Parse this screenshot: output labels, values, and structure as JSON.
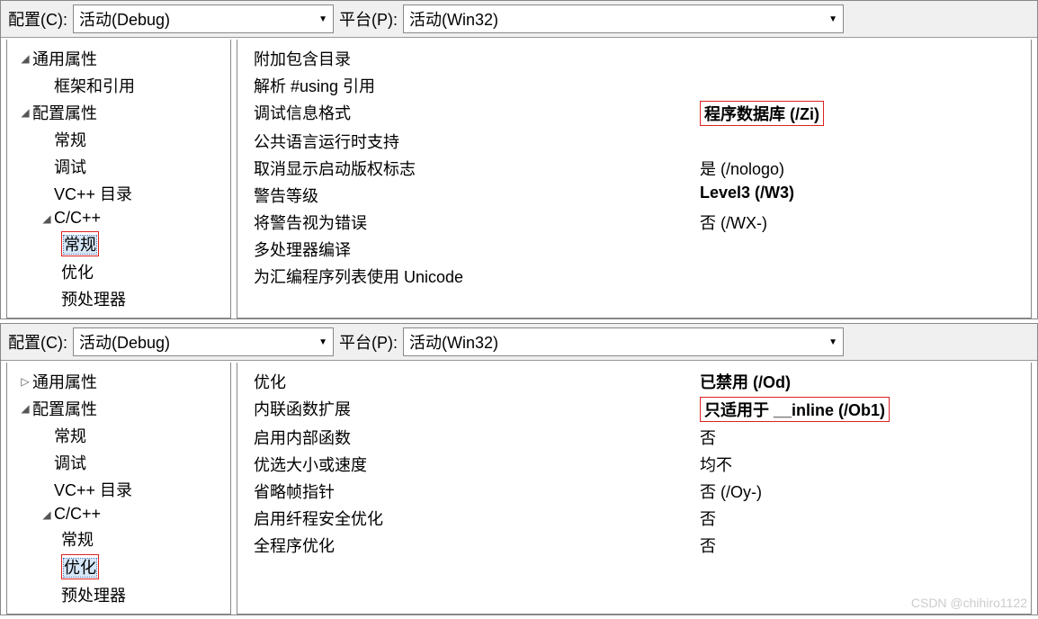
{
  "toolbar": {
    "config_label": "配置(C):",
    "config_value": "活动(Debug)",
    "platform_label": "平台(P):",
    "platform_value": "活动(Win32)"
  },
  "tree1": {
    "common": "通用属性",
    "framework": "框架和引用",
    "config": "配置属性",
    "general": "常规",
    "debug": "调试",
    "vcdir": "VC++ 目录",
    "ccpp": "C/C++",
    "ccpp_general": "常规",
    "ccpp_opt": "优化",
    "ccpp_pre": "预处理器"
  },
  "grid1": {
    "r0": {
      "label": "附加包含目录",
      "value": ""
    },
    "r1": {
      "label": "解析 #using 引用",
      "value": ""
    },
    "r2": {
      "label": "调试信息格式",
      "value": "程序数据库 (/Zi)"
    },
    "r3": {
      "label": "公共语言运行时支持",
      "value": ""
    },
    "r4": {
      "label": "取消显示启动版权标志",
      "value": "是 (/nologo)"
    },
    "r5": {
      "label": "警告等级",
      "value": "Level3 (/W3)"
    },
    "r6": {
      "label": "将警告视为错误",
      "value": "否 (/WX-)"
    },
    "r7": {
      "label": "多处理器编译",
      "value": ""
    },
    "r8": {
      "label": "为汇编程序列表使用 Unicode",
      "value": ""
    }
  },
  "tree2": {
    "common": "通用属性",
    "config": "配置属性",
    "general": "常规",
    "debug": "调试",
    "vcdir": "VC++ 目录",
    "ccpp": "C/C++",
    "ccpp_general": "常规",
    "ccpp_opt": "优化",
    "ccpp_pre": "预处理器"
  },
  "grid2": {
    "r0": {
      "label": "优化",
      "value": "已禁用 (/Od)"
    },
    "r1": {
      "label": "内联函数扩展",
      "value": "只适用于 __inline (/Ob1)"
    },
    "r2": {
      "label": "启用内部函数",
      "value": "否"
    },
    "r3": {
      "label": "优选大小或速度",
      "value": "均不"
    },
    "r4": {
      "label": "省略帧指针",
      "value": "否 (/Oy-)"
    },
    "r5": {
      "label": "启用纤程安全优化",
      "value": "否"
    },
    "r6": {
      "label": "全程序优化",
      "value": "否"
    }
  },
  "watermark": "CSDN @chihiro1122"
}
